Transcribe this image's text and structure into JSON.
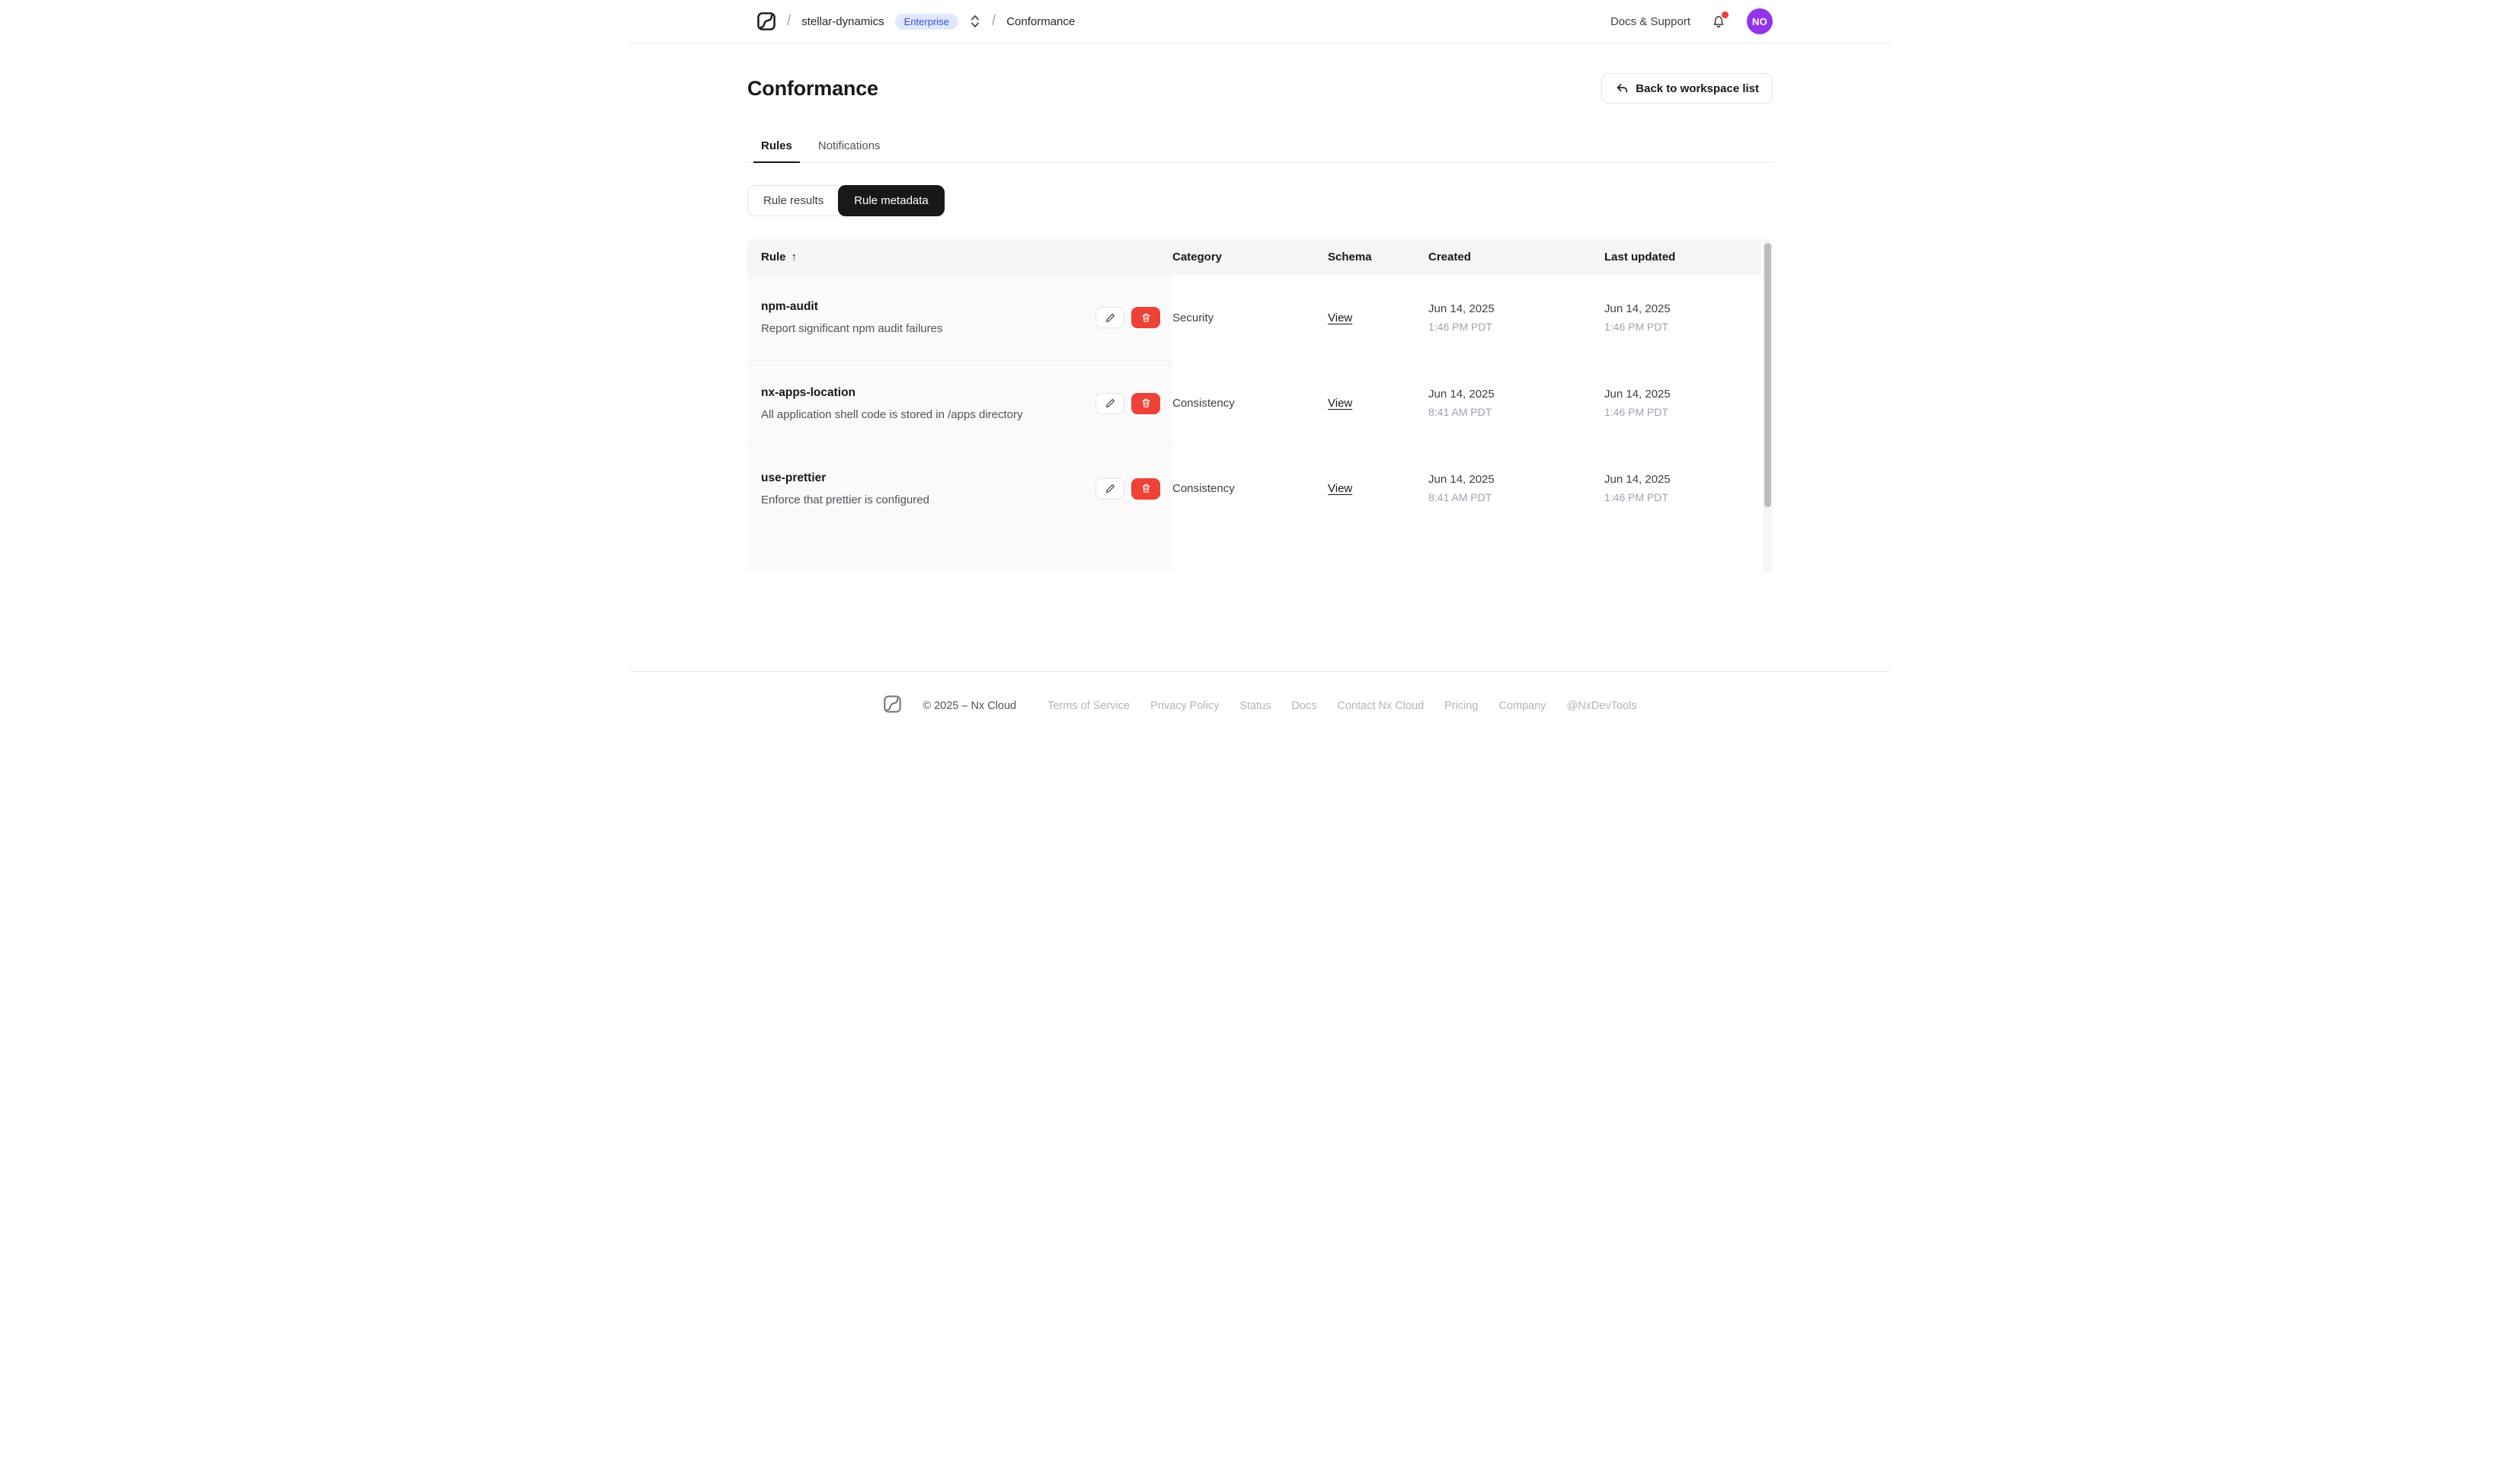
{
  "navbar": {
    "breadcrumb": {
      "separator": "/",
      "workspace": "stellar-dynamics",
      "plan_badge": "Enterprise",
      "page": "Conformance"
    },
    "docs_support": "Docs & Support",
    "avatar_initials": "NO"
  },
  "page": {
    "title": "Conformance",
    "back_label": "Back to workspace list"
  },
  "tabs": [
    {
      "label": "Rules",
      "active": true
    },
    {
      "label": "Notifications",
      "active": false
    }
  ],
  "segmented": [
    {
      "label": "Rule results",
      "active": false
    },
    {
      "label": "Rule metadata",
      "active": true
    }
  ],
  "table": {
    "columns": [
      "Rule",
      "Category",
      "Schema",
      "Created",
      "Last updated"
    ],
    "sort_column": "Rule",
    "sort_direction": "asc",
    "sort_indicator": "↑",
    "rows": [
      {
        "name": "npm-audit",
        "description": "Report significant npm audit failures",
        "category": "Security",
        "schema_label": "View",
        "created": {
          "date": "Jun 14, 2025",
          "time": "1:46 PM PDT"
        },
        "updated": {
          "date": "Jun 14, 2025",
          "time": "1:46 PM PDT"
        }
      },
      {
        "name": "nx-apps-location",
        "description": "All application shell code is stored in /apps directory",
        "category": "Consistency",
        "schema_label": "View",
        "created": {
          "date": "Jun 14, 2025",
          "time": "8:41 AM PDT"
        },
        "updated": {
          "date": "Jun 14, 2025",
          "time": "1:46 PM PDT"
        }
      },
      {
        "name": "use-prettier",
        "description": "Enforce that prettier is configured",
        "category": "Consistency",
        "schema_label": "View",
        "created": {
          "date": "Jun 14, 2025",
          "time": "8:41 AM PDT"
        },
        "updated": {
          "date": "Jun 14, 2025",
          "time": "1:46 PM PDT"
        }
      }
    ]
  },
  "footer": {
    "copyright": "© 2025 – Nx Cloud",
    "links": [
      "Terms of Service",
      "Privacy Policy",
      "Status",
      "Docs",
      "Contact Nx Cloud",
      "Pricing",
      "Company",
      "@NxDevTools"
    ]
  },
  "colors": {
    "accent": "#18181b",
    "danger": "#ee4237",
    "badge_bg": "#e0e7ff",
    "badge_text": "#3451db",
    "avatar_bg": "#9333ea",
    "notification_dot": "#f03e3e",
    "table_bg": "#fafafa"
  }
}
